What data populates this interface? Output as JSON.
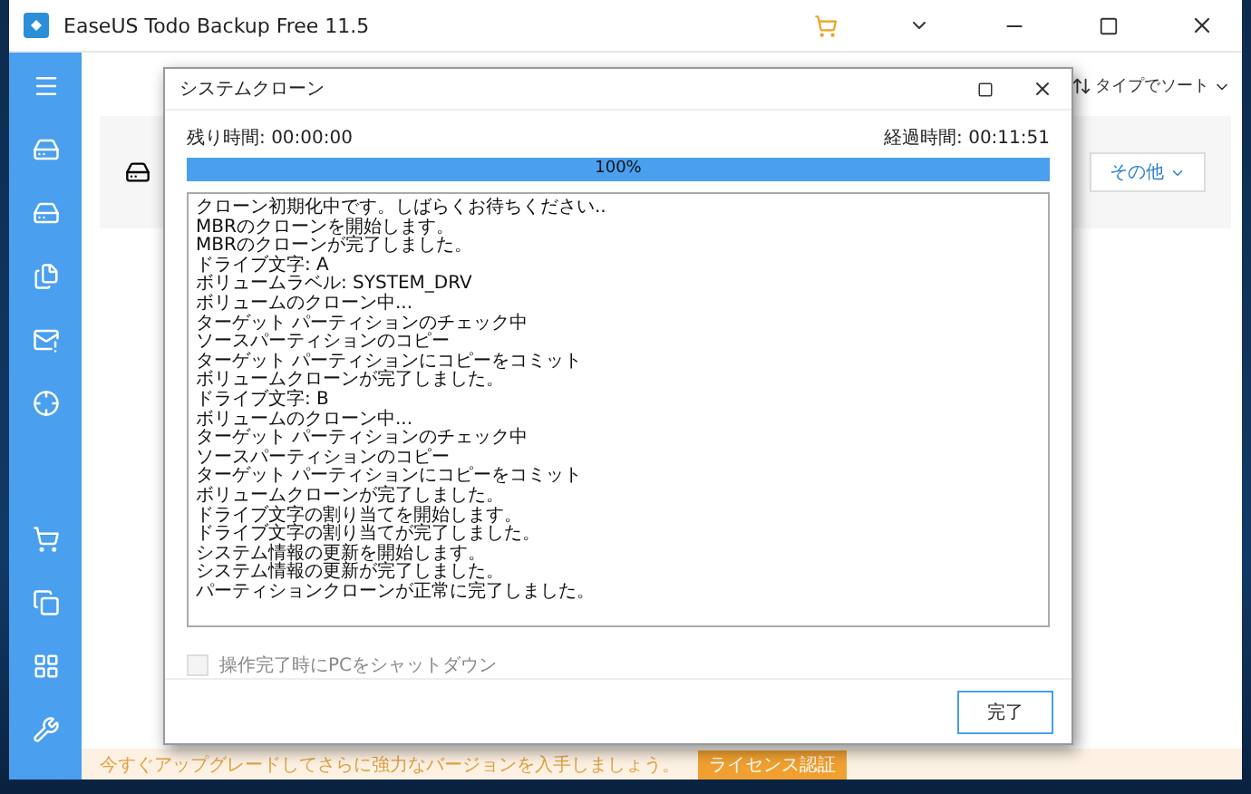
{
  "window": {
    "title": "EaseUS Todo Backup Free 11.5"
  },
  "sidebar": {
    "items": [
      {
        "kind": "menu"
      },
      {
        "kind": "disk"
      },
      {
        "kind": "system"
      },
      {
        "kind": "file"
      },
      {
        "kind": "mail"
      },
      {
        "kind": "target"
      },
      {
        "kind": "cart"
      },
      {
        "kind": "clone"
      },
      {
        "kind": "apps"
      },
      {
        "kind": "tools"
      }
    ]
  },
  "toolbar": {
    "sort": "タイプでソート",
    "more": "その他"
  },
  "dialog": {
    "title": "システムクローン",
    "remaining_label": "残り時間:",
    "remaining": "00:00:00",
    "elapsed_label": "経過時間:",
    "elapsed": "00:11:51",
    "progress": {
      "level": 1,
      "reading": "100%"
    },
    "log": [
      "クローン初期化中です。しばらくお待ちください..",
      "MBRのクローンを開始します。",
      "MBRのクローンが完了しました。",
      "ドライブ文字: A",
      "ボリュームラベル: SYSTEM_DRV",
      "ボリュームのクローン中...",
      "ターゲット パーティションのチェック中",
      "ソースパーティションのコピー",
      "ターゲット パーティションにコピーをコミット",
      "ボリュームクローンが完了しました。",
      "ドライブ文字: B",
      "ボリュームのクローン中...",
      "ターゲット パーティションのチェック中",
      "ソースパーティションのコピー",
      "ターゲット パーティションにコピーをコミット",
      "ボリュームクローンが完了しました。",
      "ドライブ文字の割り当てを開始します。",
      "ドライブ文字の割り当てが完了しました。",
      "システム情報の更新を開始します。",
      "システム情報の更新が完了しました。",
      "パーティションクローンが正常に完了しました。"
    ],
    "shutdown": {
      "label": "操作完了時にPCをシャットダウン",
      "checked": false,
      "disabled": true
    },
    "button": "完了"
  },
  "banner": {
    "text": "今すぐアップグレードしてさらに強力なバージョンを入手しましょう。",
    "button": "ライセンス認証"
  }
}
